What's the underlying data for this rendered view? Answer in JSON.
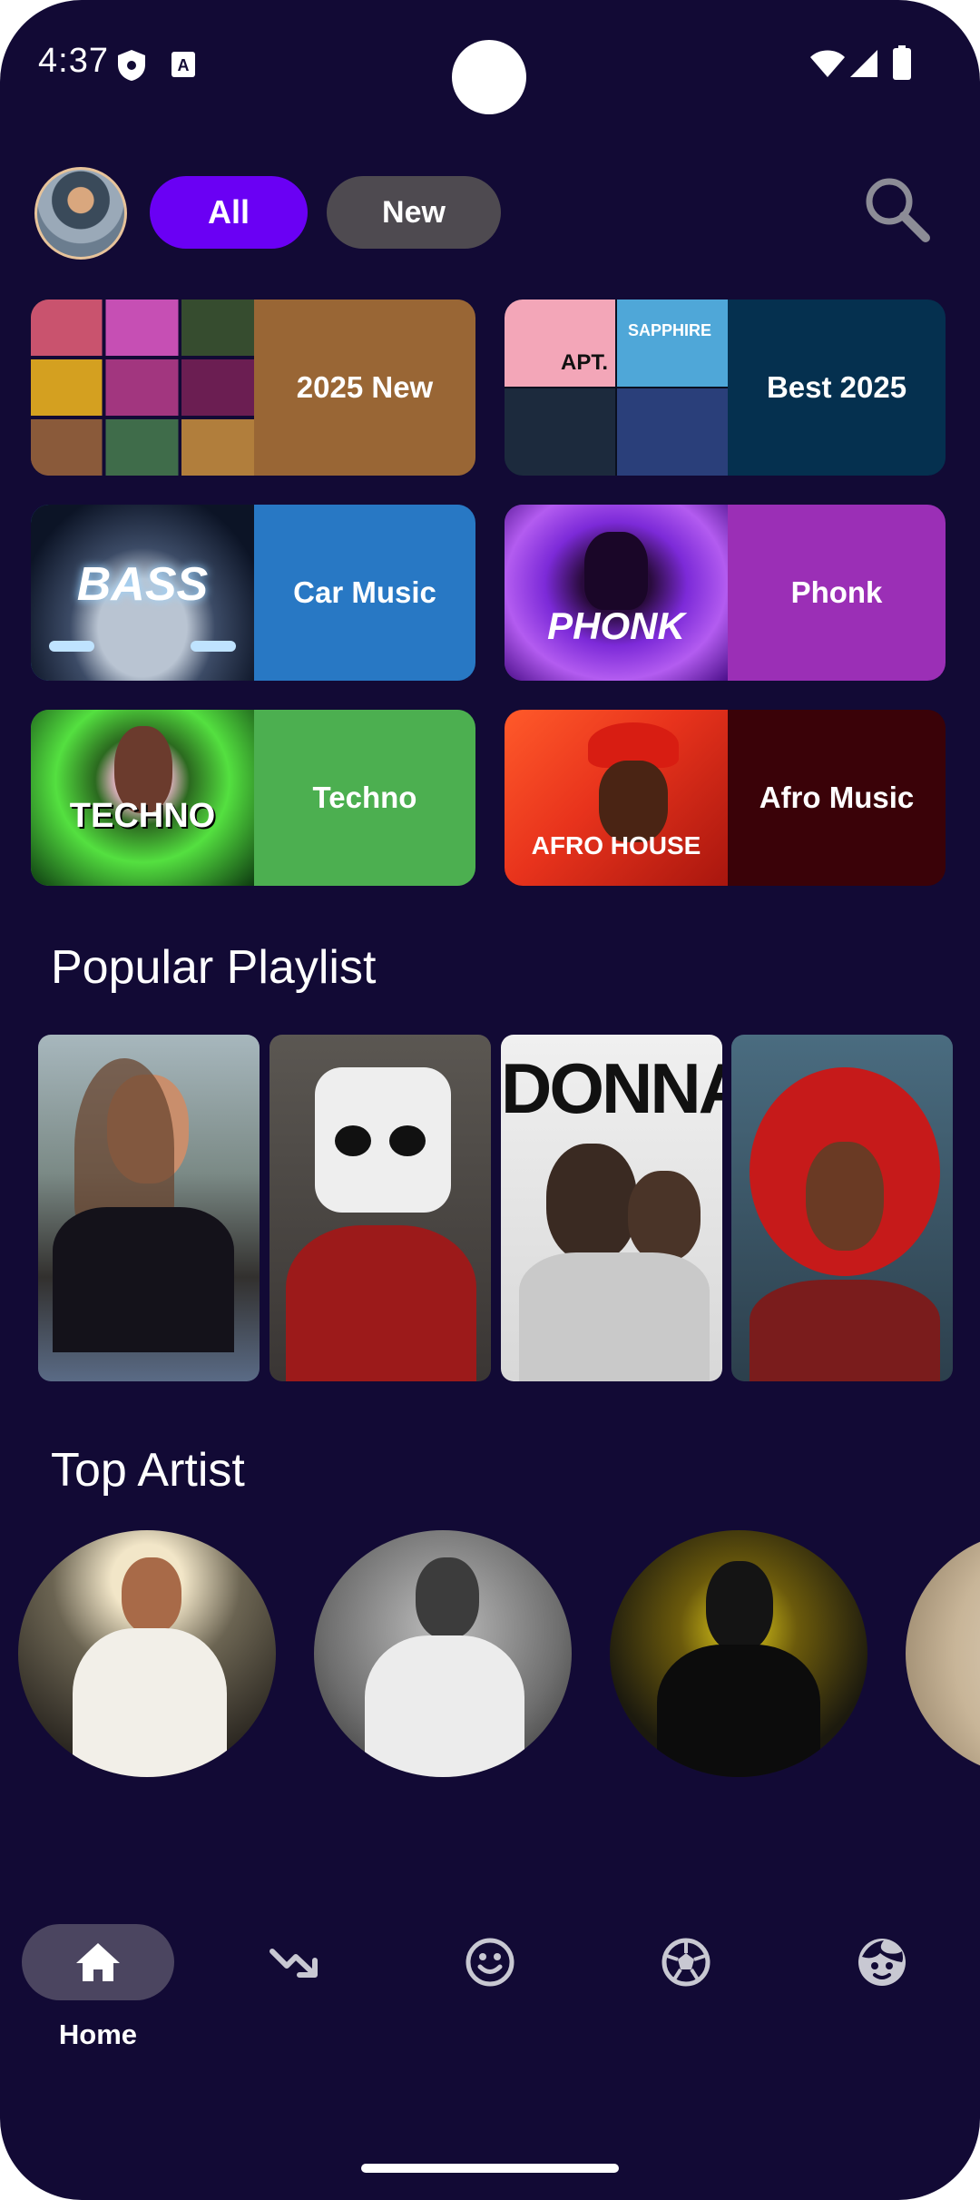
{
  "status": {
    "time": "4:37"
  },
  "header": {
    "chips": [
      "All",
      "New"
    ]
  },
  "categories": [
    {
      "label": "2025 New",
      "bg": "#996635"
    },
    {
      "label": "Best 2025",
      "bg": "#05304f"
    },
    {
      "label": "Car Music",
      "bg": "#2878c4"
    },
    {
      "label": "Phonk",
      "bg": "#9b2fb6"
    },
    {
      "label": "Techno",
      "bg": "#4caf50"
    },
    {
      "label": "Afro Music",
      "bg": "#3a0208"
    }
  ],
  "art_text": {
    "bass": "BASS",
    "phonk": "PHONK",
    "techno": "TECHNO",
    "afro": "AFRO HOUSE",
    "apt": "APT.",
    "sapphire": "SAPPHIRE",
    "donna": "DONNA"
  },
  "sections": {
    "popular": "Popular Playlist",
    "artists": "Top Artist"
  },
  "nav": {
    "home": "Home"
  },
  "colors": {
    "background": "#120a35",
    "accent": "#6a00f4"
  }
}
